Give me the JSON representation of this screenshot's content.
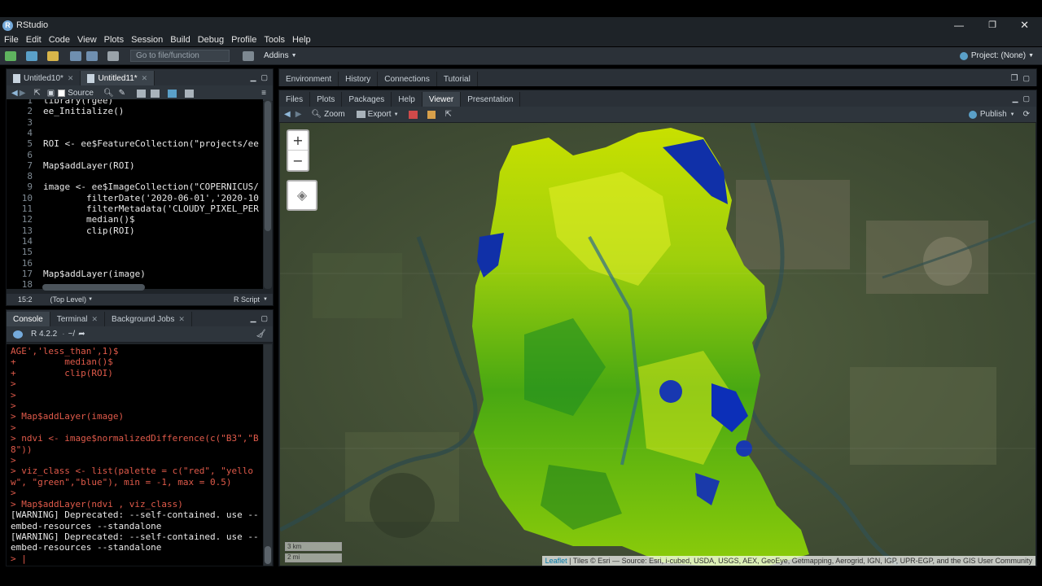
{
  "app": {
    "title": "RStudio",
    "logo": "R"
  },
  "menu": [
    "File",
    "Edit",
    "Code",
    "View",
    "Plots",
    "Session",
    "Build",
    "Debug",
    "Profile",
    "Tools",
    "Help"
  ],
  "toolbar": {
    "goto_placeholder": "Go to file/function",
    "addins": "Addins",
    "project": "Project: (None)"
  },
  "editor": {
    "tabs": [
      {
        "label": "Untitled10*"
      },
      {
        "label": "Untitled11*"
      }
    ],
    "source_label": "Source",
    "lines": [
      {
        "n": "1",
        "t": "library(rgee)"
      },
      {
        "n": "2",
        "t": "ee_Initialize()"
      },
      {
        "n": "3",
        "t": ""
      },
      {
        "n": "4",
        "t": ""
      },
      {
        "n": "5",
        "t": "ROI <- ee$FeatureCollection(\"projects/ee"
      },
      {
        "n": "6",
        "t": ""
      },
      {
        "n": "7",
        "t": "Map$addLayer(ROI)"
      },
      {
        "n": "8",
        "t": ""
      },
      {
        "n": "9",
        "t": "image <- ee$ImageCollection(\"COPERNICUS/"
      },
      {
        "n": "10",
        "t": "        filterDate('2020-06-01','2020-10"
      },
      {
        "n": "11",
        "t": "        filterMetadata('CLOUDY_PIXEL_PER"
      },
      {
        "n": "12",
        "t": "        median()$"
      },
      {
        "n": "13",
        "t": "        clip(ROI)"
      },
      {
        "n": "14",
        "t": ""
      },
      {
        "n": "15",
        "t": ""
      },
      {
        "n": "16",
        "t": ""
      },
      {
        "n": "17",
        "t": "Map$addLayer(image)"
      },
      {
        "n": "18",
        "t": ""
      }
    ],
    "status_pos": "15:2",
    "status_scope": "(Top Level)",
    "status_type": "R Script"
  },
  "console": {
    "tabs": [
      {
        "label": "Console"
      },
      {
        "label": "Terminal"
      },
      {
        "label": "Background Jobs"
      }
    ],
    "r_version": "R 4.2.2",
    "path": "~/",
    "lines": [
      {
        "t": "AGE','less_than',1)$",
        "kind": "in"
      },
      {
        "t": "+         median()$",
        "kind": "in"
      },
      {
        "t": "+         clip(ROI)",
        "kind": "in"
      },
      {
        "t": ">",
        "kind": "in"
      },
      {
        "t": ">",
        "kind": "in"
      },
      {
        "t": ">",
        "kind": "in"
      },
      {
        "t": "> Map$addLayer(image)",
        "kind": "in"
      },
      {
        "t": ">",
        "kind": "in"
      },
      {
        "t": "> ndvi <- image$normalizedDifference(c(\"B3\",\"B",
        "kind": "in"
      },
      {
        "t": "8\"))",
        "kind": "in"
      },
      {
        "t": ">",
        "kind": "in"
      },
      {
        "t": "> viz_class <- list(palette = c(\"red\", \"yello",
        "kind": "in"
      },
      {
        "t": "w\", \"green\",\"blue\"), min = -1, max = 0.5)",
        "kind": "in"
      },
      {
        "t": ">",
        "kind": "in"
      },
      {
        "t": "> Map$addLayer(ndvi , viz_class)",
        "kind": "in"
      },
      {
        "t": "[WARNING] Deprecated: --self-contained. use --",
        "kind": "out"
      },
      {
        "t": "embed-resources --standalone",
        "kind": "out"
      },
      {
        "t": "[WARNING] Deprecated: --self-contained. use --",
        "kind": "out"
      },
      {
        "t": "embed-resources --standalone",
        "kind": "out"
      },
      {
        "t": "> |",
        "kind": "in"
      }
    ]
  },
  "env_tabs": [
    "Environment",
    "History",
    "Connections",
    "Tutorial"
  ],
  "viewer": {
    "tabs": [
      "Files",
      "Plots",
      "Packages",
      "Help",
      "Viewer",
      "Presentation"
    ],
    "zoom": "Zoom",
    "export": "Export",
    "publish": "Publish",
    "map": {
      "zoom_in": "+",
      "zoom_out": "−",
      "scale_km": "3 km",
      "scale_mi": "2 mi",
      "attribution_leaflet": "Leaflet",
      "attribution_rest": "| Tiles © Esri — Source: Esri, i-cubed, USDA, USGS, AEX, GeoEye, Getmapping, Aerogrid, IGN, IGP, UPR-EGP, and the GIS User Community"
    }
  },
  "colors": {
    "ndvi_palette": [
      "#ff0000",
      "#ffff00",
      "#008000",
      "#0000ff"
    ],
    "console_input": "#e05a4a",
    "editor_bg": "#000000",
    "chrome": "#1e2328"
  }
}
